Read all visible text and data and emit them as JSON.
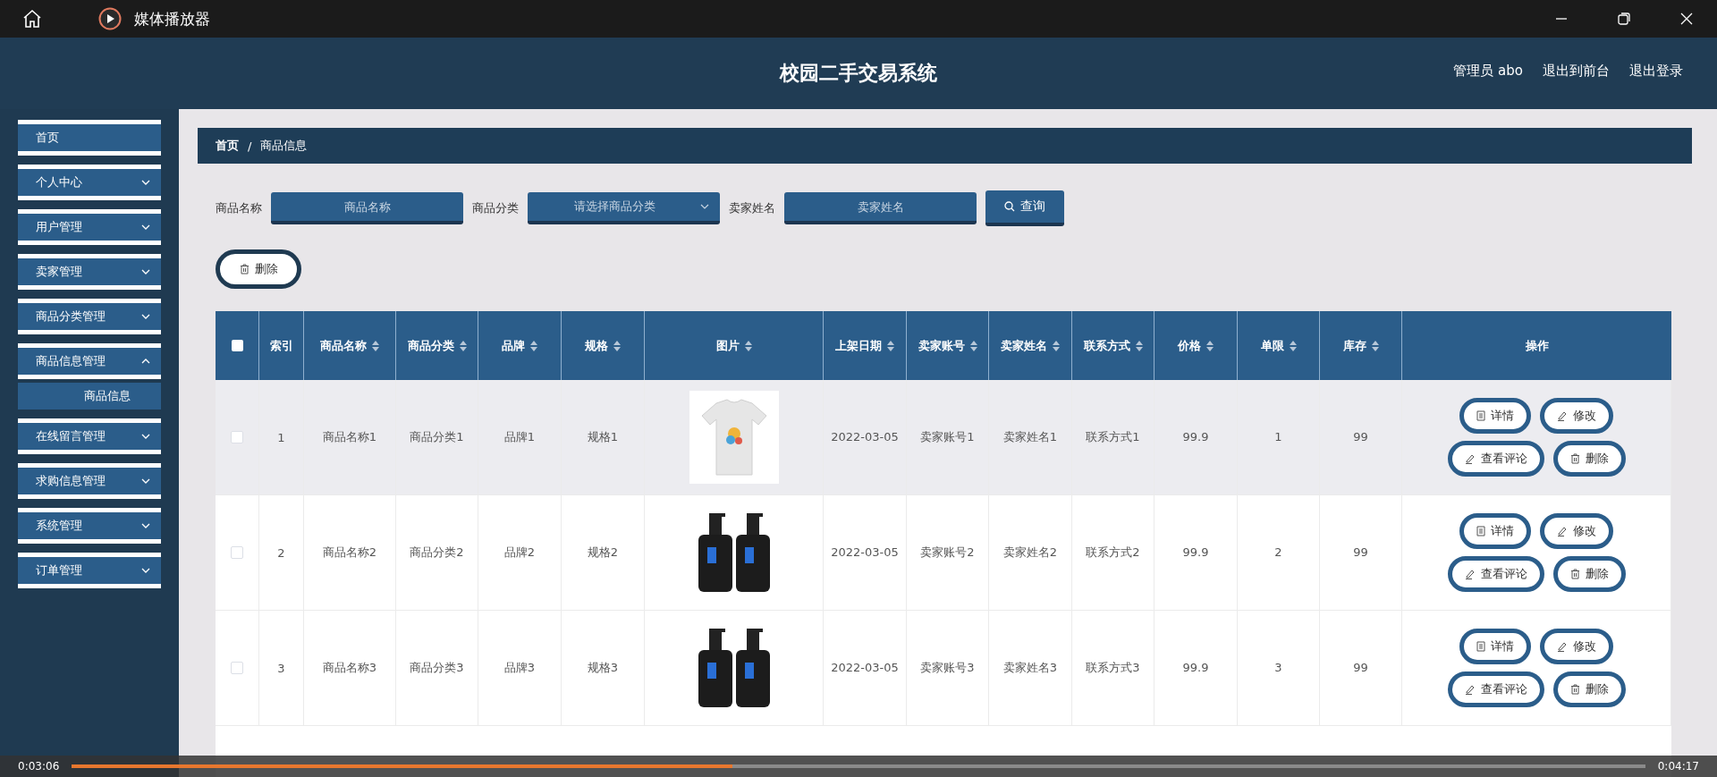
{
  "window": {
    "title": "媒体播放器"
  },
  "header": {
    "title": "校园二手交易系统",
    "user": "管理员 abo",
    "links": [
      "退出到前台",
      "退出登录"
    ]
  },
  "sidebar": {
    "items": [
      {
        "label": "首页",
        "kind": "link"
      },
      {
        "label": "个人中心",
        "kind": "menu",
        "expanded": false
      },
      {
        "label": "用户管理",
        "kind": "menu",
        "expanded": false
      },
      {
        "label": "卖家管理",
        "kind": "menu",
        "expanded": false
      },
      {
        "label": "商品分类管理",
        "kind": "menu",
        "expanded": false
      },
      {
        "label": "商品信息管理",
        "kind": "menu",
        "expanded": true,
        "children": [
          {
            "label": "商品信息",
            "selected": true
          }
        ]
      },
      {
        "label": "在线留言管理",
        "kind": "menu",
        "expanded": false
      },
      {
        "label": "求购信息管理",
        "kind": "menu",
        "expanded": false
      },
      {
        "label": "系统管理",
        "kind": "menu",
        "expanded": false
      },
      {
        "label": "订单管理",
        "kind": "menu",
        "expanded": false
      }
    ]
  },
  "breadcrumb": [
    "首页",
    "/",
    "商品信息"
  ],
  "search": {
    "fields": [
      {
        "label": "商品名称",
        "placeholder": "商品名称",
        "kind": "input"
      },
      {
        "label": "商品分类",
        "placeholder": "请选择商品分类",
        "kind": "select"
      },
      {
        "label": "卖家姓名",
        "placeholder": "卖家姓名",
        "kind": "input"
      }
    ],
    "button": "查询"
  },
  "delete_button": "删除",
  "table": {
    "select_all": {
      "checked": false
    },
    "columns": [
      {
        "label": "索引",
        "sortable": false
      },
      {
        "label": "商品名称",
        "sortable": true
      },
      {
        "label": "商品分类",
        "sortable": true
      },
      {
        "label": "品牌",
        "sortable": true
      },
      {
        "label": "规格",
        "sortable": true
      },
      {
        "label": "图片",
        "sortable": true
      },
      {
        "label": "上架日期",
        "sortable": true
      },
      {
        "label": "卖家账号",
        "sortable": true
      },
      {
        "label": "卖家姓名",
        "sortable": true
      },
      {
        "label": "联系方式",
        "sortable": true
      },
      {
        "label": "价格",
        "sortable": true
      },
      {
        "label": "单限",
        "sortable": true
      },
      {
        "label": "库存",
        "sortable": true
      },
      {
        "label": "操作",
        "sortable": false
      }
    ],
    "rows": [
      {
        "checked": false,
        "hovered": true,
        "cells": [
          "1",
          "商品名称1",
          "商品分类1",
          "品牌1",
          "规格1"
        ],
        "image": {
          "kind": "picture"
        },
        "rest": [
          "2022-03-05",
          "卖家账号1",
          "卖家姓名1",
          "联系方式1",
          "99.9",
          "1",
          "99"
        ],
        "actions": [
          {
            "label": "详情",
            "kind": "doc"
          },
          {
            "label": "修改",
            "kind": "pen"
          },
          {
            "label": "查看评论",
            "kind": "pen"
          },
          {
            "label": "删除",
            "kind": "trash"
          }
        ]
      },
      {
        "checked": false,
        "hovered": false,
        "cells": [
          "2",
          "商品名称2",
          "商品分类2",
          "品牌2",
          "规格2"
        ],
        "image": {
          "kind": "picture"
        },
        "rest": [
          "2022-03-05",
          "卖家账号2",
          "卖家姓名2",
          "联系方式2",
          "99.9",
          "2",
          "99"
        ],
        "actions": [
          {
            "label": "详情",
            "kind": "doc"
          },
          {
            "label": "修改",
            "kind": "pen"
          },
          {
            "label": "查看评论",
            "kind": "pen"
          },
          {
            "label": "删除",
            "kind": "trash"
          }
        ]
      },
      {
        "checked": false,
        "hovered": false,
        "cells": [
          "3",
          "商品名称3",
          "商品分类3",
          "品牌3",
          "规格3"
        ],
        "image": {
          "kind": "picture"
        },
        "rest": [
          "2022-03-05",
          "卖家账号3",
          "卖家姓名3",
          "联系方式3",
          "99.9",
          "3",
          "99"
        ],
        "actions": [
          {
            "label": "详情",
            "kind": "doc"
          },
          {
            "label": "修改",
            "kind": "pen"
          },
          {
            "label": "查看评论",
            "kind": "pen"
          },
          {
            "label": "删除",
            "kind": "trash"
          }
        ]
      }
    ]
  },
  "player": {
    "elapsed": "0:03:06",
    "total": "0:04:17",
    "level": 0.42
  }
}
